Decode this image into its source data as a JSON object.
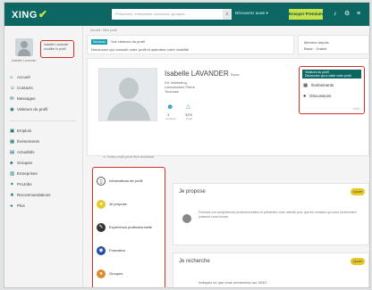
{
  "topbar": {
    "logo": "XING",
    "logo_mark": "✔",
    "search_placeholder": "Personnes, entreprises, annonces, groupes ...",
    "search_icon": "search-icon",
    "link": "Découvrez aussi ▾",
    "premium_label": "Essayer Premium",
    "icons": [
      "bell-icon",
      "settings-icon",
      "more-icon"
    ]
  },
  "left_nav": {
    "me_text": "Isabelle Lavander",
    "me_box": "Isabelle Lavander modifier le profil",
    "items": [
      {
        "icon": "home-icon",
        "label": "Accueil"
      },
      {
        "icon": "contacts-icon",
        "label": "Contacts"
      },
      {
        "icon": "messages-icon",
        "label": "Messages"
      },
      {
        "icon": "visitors-icon",
        "label": "Visiteurs du profil"
      },
      {
        "icon": "jobs-icon",
        "label": "Emplois"
      },
      {
        "icon": "events-icon",
        "label": "Événements"
      },
      {
        "icon": "news-icon",
        "label": "Actualités"
      },
      {
        "icon": "groups-icon",
        "label": "Groupes"
      },
      {
        "icon": "companies-icon",
        "label": "Entreprises"
      },
      {
        "icon": "projobs-icon",
        "label": "ProJobs"
      },
      {
        "icon": "recommendations-icon",
        "label": "Recommandations"
      },
      {
        "icon": "more-icon",
        "label": "Plus"
      }
    ]
  },
  "main": {
    "breadcrumb": "Accueil › Mon profil",
    "notice": {
      "badge": "Nouveau",
      "line1": "Vos visiteurs du profil",
      "line2": "Découvrez qui consulte votre profil et optimisez votre visibilité"
    },
    "member": {
      "line1": "Membre depuis",
      "line2": "Basic · Gratuit"
    },
    "profile": {
      "name": "Isabelle LAVANDER",
      "status": "Basic",
      "title_lines": [
        "Dir. Marketing",
        "Laboratoires Pierre",
        "Toulouse"
      ],
      "stats": [
        {
          "icon": "contacts-icon",
          "value": "3",
          "label": "Contacts"
        },
        {
          "icon": "visitors-icon",
          "value": "32%",
          "label": "Profil"
        }
      ],
      "panel_title": "Visiteurs du profil",
      "panel_subtitle": "Découvrez qui a visité votre profil",
      "panel_rows": [
        {
          "icon": "calendar-icon",
          "label": "Événements"
        },
        {
          "icon": "groups-icon",
          "label": "Discussions"
        }
      ],
      "panel_more": "Voir ›"
    },
    "tips": "Votre profil peut être amélioré",
    "section_menu": [
      {
        "icon": "document-icon",
        "label": "Informations de profil",
        "color": "#ffffff"
      },
      {
        "icon": "offer-icon",
        "label": "Je propose",
        "color": "#e8c72b"
      },
      {
        "icon": "experience-icon",
        "label": "Expérience professionnelle",
        "color": "#333333"
      },
      {
        "icon": "education-icon",
        "label": "Formation",
        "color": "#1f4aa0"
      },
      {
        "icon": "groups-icon",
        "label": "Groupes",
        "color": "#e08a2e"
      }
    ],
    "blocks": [
      {
        "title": "Je propose",
        "badge": "Ajouter",
        "text": "Précisez vos compétences professionnelles et présentez votre activité pour que les contacts qui vous recherchent puissent vous trouver."
      },
      {
        "title": "Je recherche",
        "badge": "Ajouter",
        "text": "Indiquez ce que vous recherchez sur XING"
      }
    ]
  }
}
